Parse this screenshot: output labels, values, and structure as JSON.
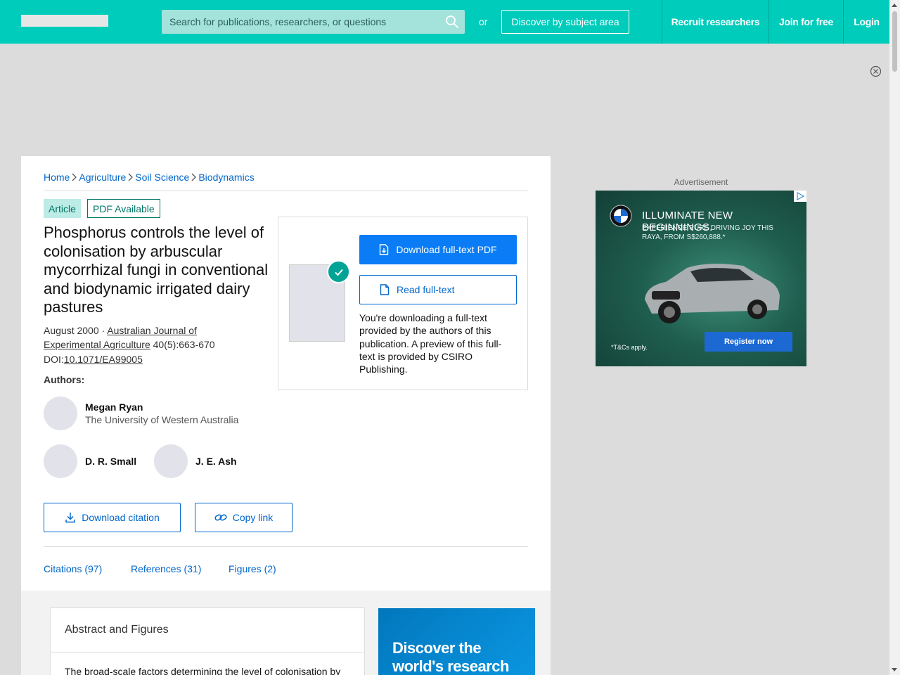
{
  "header": {
    "search_placeholder": "Search for publications, researchers, or questions",
    "or_text": "or",
    "discover_label": "Discover by subject area",
    "recruit_label": "Recruit researchers",
    "join_label": "Join for free",
    "login_label": "Login"
  },
  "breadcrumb": [
    "Home",
    "Agriculture",
    "Soil Science",
    "Biodynamics"
  ],
  "tags": {
    "type": "Article",
    "pdf": "PDF Available"
  },
  "article": {
    "title": "Phosphorus controls the level of colonisation by arbuscular mycorrhizal fungi in conventional and biodynamic irrigated dairy pastures",
    "date": "August 2000",
    "sep": " · ",
    "journal": "Australian Journal of Experimental Agriculture",
    "volume": " 40(5):663-670",
    "doi_label": "DOI:",
    "doi": "10.1071/EA99005",
    "authors_label": "Authors:"
  },
  "authors": [
    {
      "name": "Megan Ryan",
      "affiliation": "The University of Western Australia"
    },
    {
      "name": "D. R. Small"
    },
    {
      "name": "J. E. Ash"
    }
  ],
  "actions": {
    "download_citation": "Download citation",
    "copy_link": "Copy link"
  },
  "tabs": [
    "Citations (97)",
    "References (31)",
    "Figures (2)"
  ],
  "download_box": {
    "download_pdf": "Download full-text PDF",
    "read_fulltext": "Read full-text",
    "note": "You're downloading a full-text provided by the authors of this publication. A preview of this full-text is provided by CSIRO Publishing."
  },
  "ad": {
    "label": "Advertisement",
    "headline": "ILLUMINATE NEW BEGINNINGS.",
    "sub": "EXPERIENCE PURE DRIVING JOY THIS RAYA, FROM S$260,888.*",
    "cta": "Register now",
    "terms": "*T&Cs apply."
  },
  "abstract": {
    "title": "Abstract and Figures",
    "text": "The broad-scale factors determining the level of colonisation by"
  },
  "promo": {
    "text": "Discover the world's research"
  },
  "colors": {
    "brand": "#00ccbb",
    "link": "#0066cc",
    "primary": "#0a7cf5"
  }
}
